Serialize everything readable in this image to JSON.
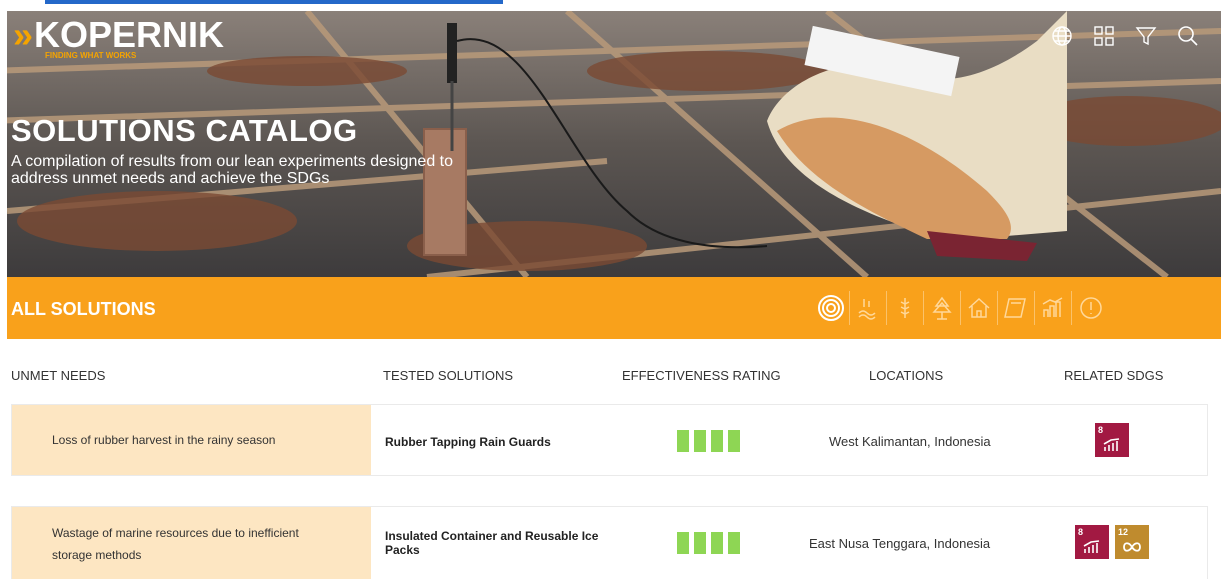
{
  "brand": {
    "mark": "»",
    "name": "KOPERNIK",
    "tagline": "FINDING WHAT WORKS",
    "accent": "#f5a400"
  },
  "header_icons": [
    "globe-icon",
    "grid-icon",
    "filter-icon",
    "search-icon"
  ],
  "hero": {
    "title": "SOLUTIONS CATALOG",
    "subtitle": "A compilation of results from our lean experiments designed to address unmet needs and achieve the SDGs"
  },
  "bar": {
    "title": "ALL SOLUTIONS",
    "color": "#f9a11b",
    "categories": [
      "target-icon",
      "water-icon",
      "agriculture-icon",
      "forest-icon",
      "housing-icon",
      "education-icon",
      "economy-icon",
      "health-icon"
    ]
  },
  "table": {
    "headers": [
      "UNMET NEEDS",
      "TESTED SOLUTIONS",
      "EFFECTIVENESS RATING",
      "LOCATIONS",
      "RELATED SDGS"
    ],
    "rows": [
      {
        "need": "Loss of rubber harvest in the rainy season",
        "solution": "Rubber Tapping Rain Guards",
        "rating": 4,
        "location": "West Kalimantan, Indonesia",
        "sdgs": [
          {
            "num": "8",
            "color": "#a21942"
          }
        ]
      },
      {
        "need": "Wastage of marine resources due to inefficient storage methods",
        "solution": "Insulated Container and Reusable Ice Packs",
        "rating": 4,
        "location": "East Nusa Tenggara, Indonesia",
        "sdgs": [
          {
            "num": "8",
            "color": "#a21942"
          },
          {
            "num": "12",
            "color": "#bf8b2e"
          }
        ]
      }
    ]
  }
}
